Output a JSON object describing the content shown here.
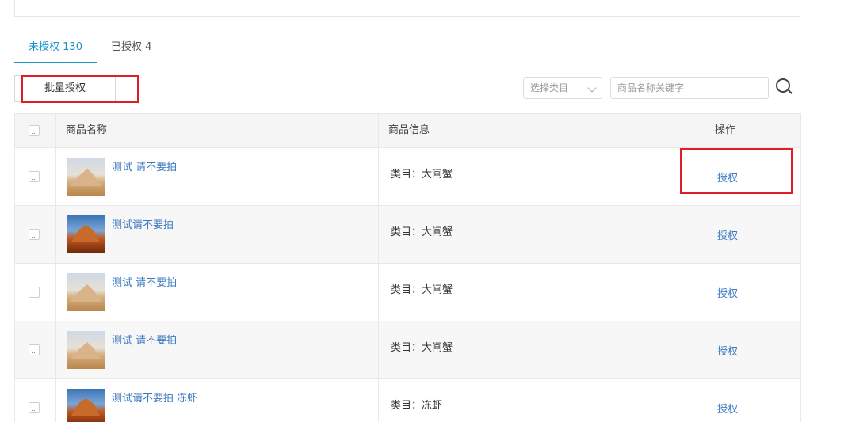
{
  "tabs": [
    {
      "label": "未授权 130",
      "active": true
    },
    {
      "label": "已授权 4",
      "active": false
    }
  ],
  "toolbar": {
    "batch_label": "批量授权",
    "category_placeholder": "选择类目",
    "search_placeholder": "商品名称关键字"
  },
  "table": {
    "headers": {
      "name": "商品名称",
      "info": "商品信息",
      "action": "操作"
    },
    "rows": [
      {
        "name": "测试 请不要拍",
        "info": "类目：大闸蟹",
        "action": "授权",
        "thumb": "desert-dune-image"
      },
      {
        "name": "测试请不要拍",
        "info": "类目：大闸蟹",
        "action": "授权",
        "thumb": "red-rock-image"
      },
      {
        "name": "测试 请不要拍",
        "info": "类目：大闸蟹",
        "action": "授权",
        "thumb": "desert-dune-image"
      },
      {
        "name": "测试 请不要拍",
        "info": "类目：大闸蟹",
        "action": "授权",
        "thumb": "desert-dune-image"
      },
      {
        "name": "测试请不要拍 冻虾",
        "info": "类目：冻虾",
        "action": "授权",
        "thumb": "red-rock-image"
      }
    ]
  },
  "colors": {
    "accent": "#1a93c8",
    "link": "#3d79c2",
    "highlight": "#e11d2a"
  }
}
